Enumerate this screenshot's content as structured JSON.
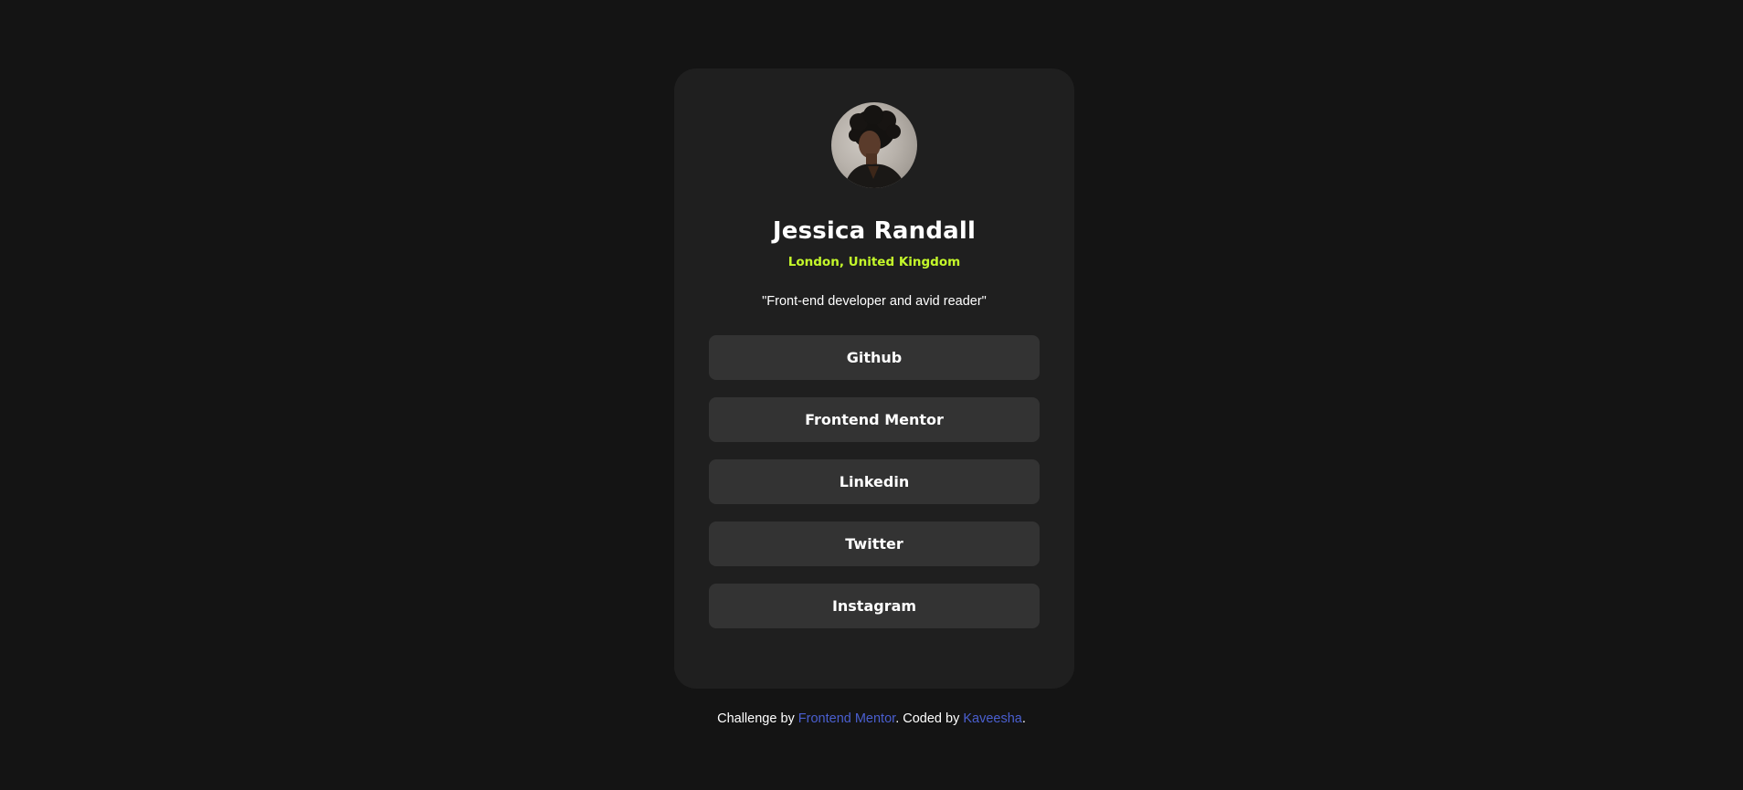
{
  "profile": {
    "avatar_icon": "profile-photo",
    "name": "Jessica Randall",
    "location": "London, United Kingdom",
    "bio": "\"Front-end developer and avid reader\""
  },
  "links": [
    {
      "label": "Github"
    },
    {
      "label": "Frontend Mentor"
    },
    {
      "label": "Linkedin"
    },
    {
      "label": "Twitter"
    },
    {
      "label": "Instagram"
    }
  ],
  "footer": {
    "prefix": "Challenge by ",
    "challenge_link": "Frontend Mentor",
    "middle": ". Coded by ",
    "author_link": "Kaveesha",
    "suffix": "."
  },
  "colors": {
    "background": "#141414",
    "card": "#1f1f1f",
    "button": "#333333",
    "accent": "#c4f82a",
    "link": "#4a5fd0"
  }
}
